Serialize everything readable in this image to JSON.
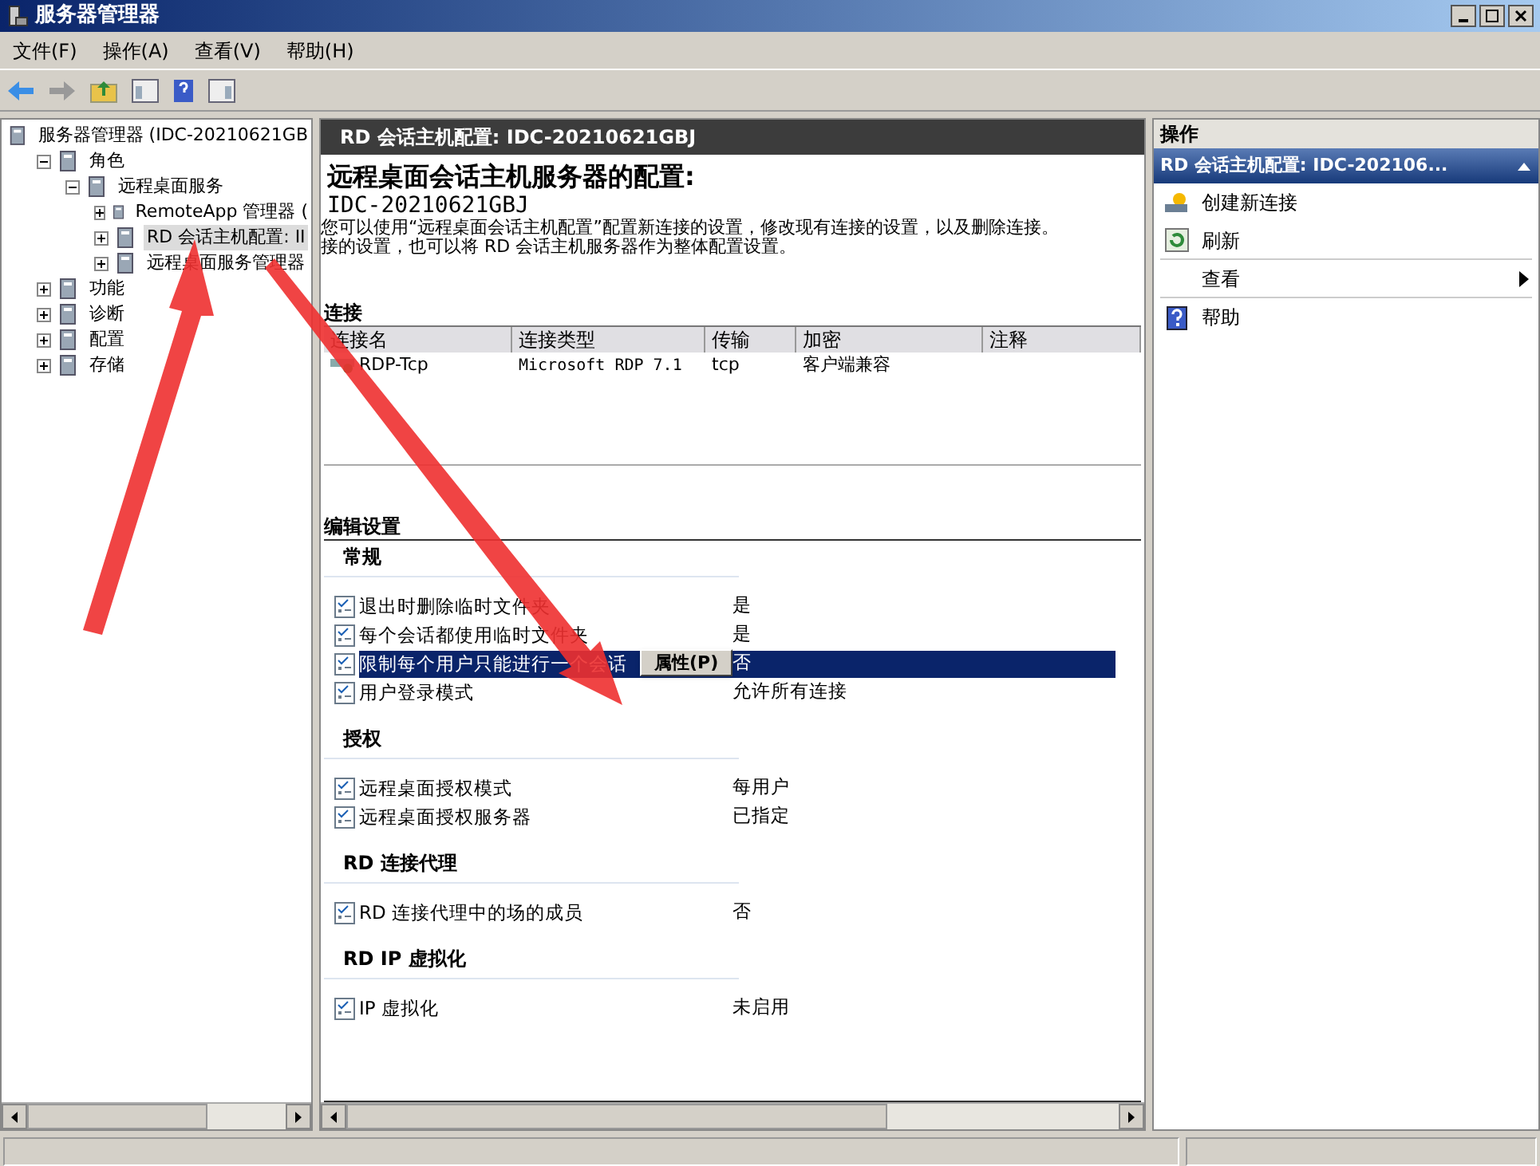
{
  "window": {
    "title": "服务器管理器"
  },
  "menu": [
    "文件(F)",
    "操作(A)",
    "查看(V)",
    "帮助(H)"
  ],
  "tree": [
    {
      "label": "服务器管理器 (IDC-20210621GB",
      "selected": false,
      "children": [
        {
          "label": "角色",
          "expanded": true,
          "selected": false,
          "children": [
            {
              "label": "远程桌面服务",
              "expanded": true,
              "selected": false,
              "children": [
                {
                  "label": "RemoteApp 管理器 (",
                  "expanded": false,
                  "selected": false
                },
                {
                  "label": "RD 会话主机配置: II",
                  "expanded": false,
                  "selected": true
                },
                {
                  "label": "远程桌面服务管理器",
                  "expanded": false,
                  "selected": false
                }
              ]
            }
          ]
        },
        {
          "label": "功能",
          "expanded": false,
          "selected": false
        },
        {
          "label": "诊断",
          "expanded": false,
          "selected": false
        },
        {
          "label": "配置",
          "expanded": false,
          "selected": false
        },
        {
          "label": "存储",
          "expanded": false,
          "selected": false
        }
      ]
    }
  ],
  "center": {
    "header": "RD 会话主机配置: IDC-20210621GBJ",
    "title": "远程桌面会话主机服务器的配置:",
    "server": "IDC-20210621GBJ",
    "description": [
      "您可以使用“远程桌面会话主机配置”配置新连接的设置，修改现有连接的设置，以及删除连接。",
      "接的设置，也可以将 RD 会话主机服务器作为整体配置设置。"
    ],
    "connections": {
      "heading": "连接",
      "columns": [
        "连接名",
        "连接类型",
        "传输",
        "加密",
        "注释"
      ],
      "rows": [
        {
          "cells": [
            "RDP-Tcp",
            "Microsoft RDP 7.1",
            "tcp",
            "客户端兼容"
          ]
        }
      ]
    },
    "settings": {
      "heading": "编辑设置",
      "groups": [
        {
          "title": "常规",
          "items": [
            {
              "name": "退出时删除临时文件夹",
              "value": "是",
              "selected": false
            },
            {
              "name": "每个会话都使用临时文件夹",
              "value": "是",
              "selected": false
            },
            {
              "name": "限制每个用户只能进行一个会话",
              "value": "否",
              "selected": true
            },
            {
              "name": "用户登录模式",
              "value": "允许所有连接",
              "selected": false
            }
          ]
        },
        {
          "title": "授权",
          "items": [
            {
              "name": "远程桌面授权模式",
              "value": "每用户",
              "selected": false
            },
            {
              "name": "远程桌面授权服务器",
              "value": "已指定",
              "selected": false
            }
          ]
        },
        {
          "title": "RD 连接代理",
          "items": [
            {
              "name": "RD 连接代理中的场的成员",
              "value": "否",
              "selected": false
            }
          ]
        },
        {
          "title": "RD IP 虚拟化",
          "items": [
            {
              "name": "IP 虚拟化",
              "value": "未启用",
              "selected": false
            }
          ]
        }
      ]
    },
    "context_menu": {
      "items": [
        "属性(P)"
      ]
    }
  },
  "actions": {
    "heading": "操作",
    "section": "RD 会话主机配置: IDC-202106...",
    "items": [
      {
        "label": "创建新连接",
        "kind": "create",
        "submenu": false,
        "divider_after": false
      },
      {
        "label": "刷新",
        "kind": "refresh",
        "submenu": false,
        "divider_after": true
      },
      {
        "label": "查看",
        "kind": "none",
        "submenu": true,
        "divider_after": true
      },
      {
        "label": "帮助",
        "kind": "help",
        "submenu": false,
        "divider_after": false
      }
    ]
  }
}
